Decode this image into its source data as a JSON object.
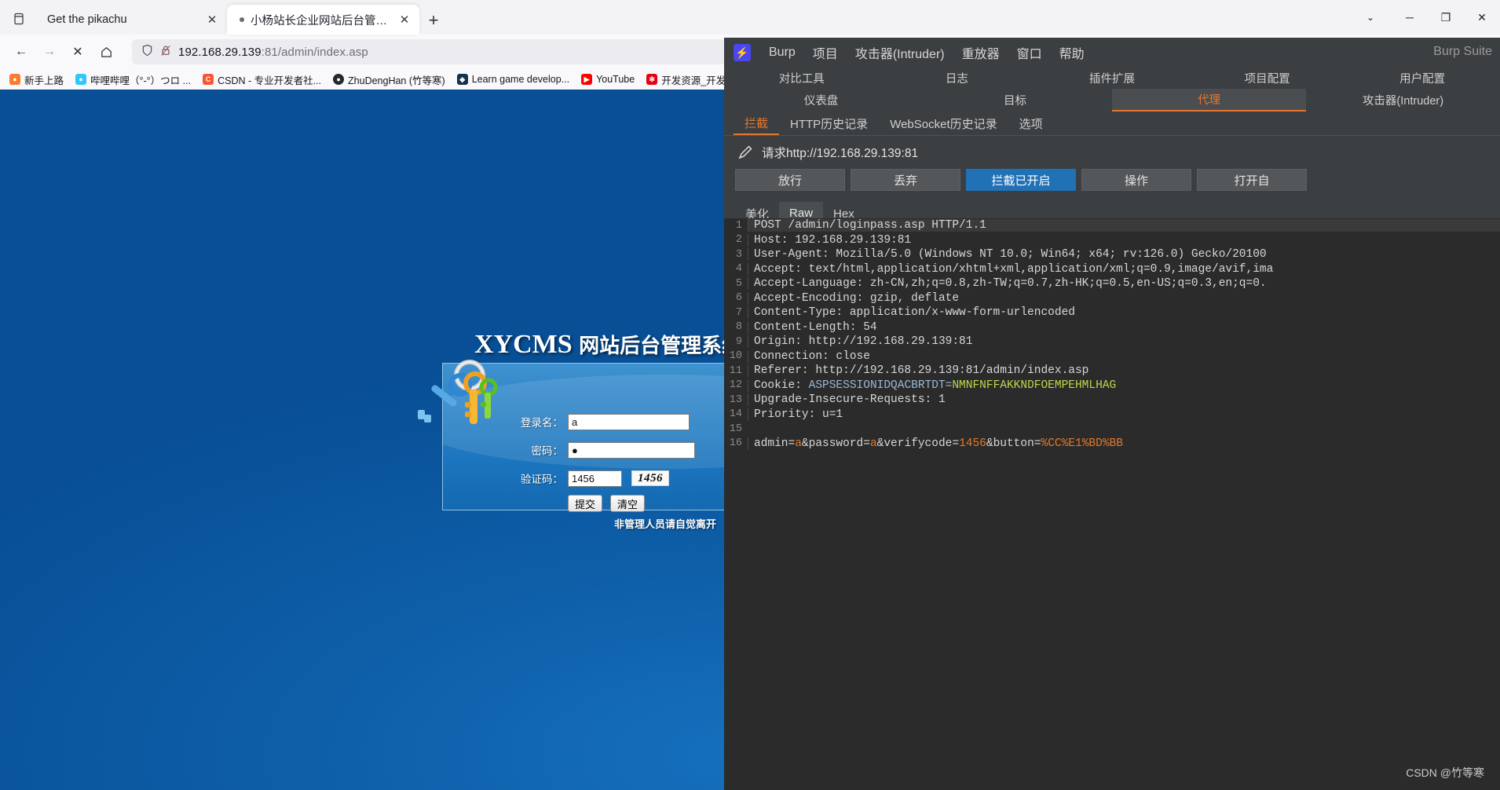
{
  "browser": {
    "tabs": [
      {
        "title": "Get the pikachu",
        "active": false,
        "close_label": "✕"
      },
      {
        "title": "小杨站长企业网站后台管理系统",
        "active": true,
        "close_label": "✕"
      }
    ],
    "new_tab_label": "+",
    "window_controls": {
      "chevron": "⌄",
      "minimize": "─",
      "maximize": "❐",
      "close": "✕"
    },
    "nav": {
      "back": "←",
      "forward": "→",
      "stop": "✕",
      "home": "⌂"
    },
    "url": {
      "prefix": "192.168.29.139",
      "suffix": ":81/admin/index.asp",
      "full": "192.168.29.139:81/admin/index.asp"
    },
    "bookmarks": [
      {
        "label": "新手上路",
        "fav": "🦊",
        "color": "#ff7a2f"
      },
      {
        "label": "哔哩哔哩（°-°）つロ ...",
        "fav": "B",
        "color": "#2ec8ff"
      },
      {
        "label": "CSDN - 专业开发者社...",
        "fav": "C",
        "color": "#fc5531"
      },
      {
        "label": "ZhuDengHan (竹等寒)",
        "fav": "●",
        "color": "#24292f"
      },
      {
        "label": "Learn game develop...",
        "fav": "◈",
        "color": "#13324b"
      },
      {
        "label": "YouTube",
        "fav": "▶",
        "color": "#ff0000"
      },
      {
        "label": "开发资源_开发",
        "fav": "✻",
        "color": "#e60012"
      }
    ]
  },
  "webpage": {
    "title_main": "XYCMS",
    "title_sub": "网站后台管理系统",
    "fields": [
      {
        "label": "登录名：",
        "value": "a"
      },
      {
        "label": "密码：",
        "value": "●"
      },
      {
        "label": "验证码：",
        "value": "1456"
      }
    ],
    "captcha_text": "1456",
    "buttons": {
      "submit": "提交",
      "clear": "清空"
    },
    "footer_note": "非管理人员请自觉离开"
  },
  "burp": {
    "brand": "Burp Suite",
    "menu": [
      "Burp",
      "项目",
      "攻击器(Intruder)",
      "重放器",
      "窗口",
      "帮助"
    ],
    "tools_row": [
      "对比工具",
      "日志",
      "插件扩展",
      "项目配置",
      "用户配置"
    ],
    "tabs_row": [
      {
        "label": "仪表盘",
        "selected": false
      },
      {
        "label": "目标",
        "selected": false
      },
      {
        "label": "代理",
        "selected": true
      },
      {
        "label": "攻击器(Intruder)",
        "selected": false
      }
    ],
    "proxy_subtabs": [
      {
        "label": "拦截",
        "selected": true
      },
      {
        "label": "HTTP历史记录",
        "selected": false
      },
      {
        "label": "WebSocket历史记录",
        "selected": false
      },
      {
        "label": "选项",
        "selected": false
      }
    ],
    "request_title": "请求http://192.168.29.139:81",
    "action_buttons": [
      {
        "label": "放行",
        "primary": false
      },
      {
        "label": "丢弃",
        "primary": false
      },
      {
        "label": "拦截已开启",
        "primary": true
      },
      {
        "label": "操作",
        "primary": false
      },
      {
        "label": "打开自",
        "primary": false
      }
    ],
    "view_tabs": [
      {
        "label": "美化",
        "selected": false
      },
      {
        "label": "Raw",
        "selected": true
      },
      {
        "label": "Hex",
        "selected": false
      }
    ],
    "request_lines": [
      {
        "n": 1,
        "text": "POST /admin/loginpass.asp HTTP/1.1",
        "highlight": true
      },
      {
        "n": 2,
        "text": "Host: 192.168.29.139:81"
      },
      {
        "n": 3,
        "text": "User-Agent: Mozilla/5.0 (Windows NT 10.0; Win64; x64; rv:126.0) Gecko/20100"
      },
      {
        "n": 4,
        "text": "Accept: text/html,application/xhtml+xml,application/xml;q=0.9,image/avif,ima"
      },
      {
        "n": 5,
        "text": "Accept-Language: zh-CN,zh;q=0.8,zh-TW;q=0.7,zh-HK;q=0.5,en-US;q=0.3,en;q=0."
      },
      {
        "n": 6,
        "text": "Accept-Encoding: gzip, deflate"
      },
      {
        "n": 7,
        "text": "Content-Type: application/x-www-form-urlencoded"
      },
      {
        "n": 8,
        "text": "Content-Length: 54"
      },
      {
        "n": 9,
        "text": "Origin: http://192.168.29.139:81"
      },
      {
        "n": 10,
        "text": "Connection: close"
      },
      {
        "n": 11,
        "text": "Referer: http://192.168.29.139:81/admin/index.asp"
      },
      {
        "n": 12,
        "text": "Cookie: ASPSESSIONIDQACBRTDT=NMNFNFFAKKNDFOEMPEHMLHAG",
        "kind": "cookie",
        "prefix": "Cookie: ",
        "name": "ASPSESSIONIDQACBRTDT=",
        "value": "NMNFNFFAKKNDFOEMPEHMLHAG"
      },
      {
        "n": 13,
        "text": "Upgrade-Insecure-Requests: 1"
      },
      {
        "n": 14,
        "text": "Priority: u=1"
      },
      {
        "n": 15,
        "text": ""
      },
      {
        "n": 16,
        "text": "admin=a&password=a&verifycode=1456&button=%CC%E1%BD%BB",
        "kind": "body",
        "parts": [
          {
            "t": "admin=",
            "c": "k"
          },
          {
            "t": "a",
            "c": "v"
          },
          {
            "t": "&password=",
            "c": "k"
          },
          {
            "t": "a",
            "c": "v"
          },
          {
            "t": "&verifycode=",
            "c": "k"
          },
          {
            "t": "1456",
            "c": "v"
          },
          {
            "t": "&button=",
            "c": "k"
          },
          {
            "t": "%CC%E1%BD%BB",
            "c": "v"
          }
        ]
      }
    ],
    "watermark": "CSDN @竹等寒"
  },
  "colors": {
    "burp_accent": "#e8762c",
    "burp_primary": "#2071b5",
    "page_blue": "#0b5aa4"
  }
}
